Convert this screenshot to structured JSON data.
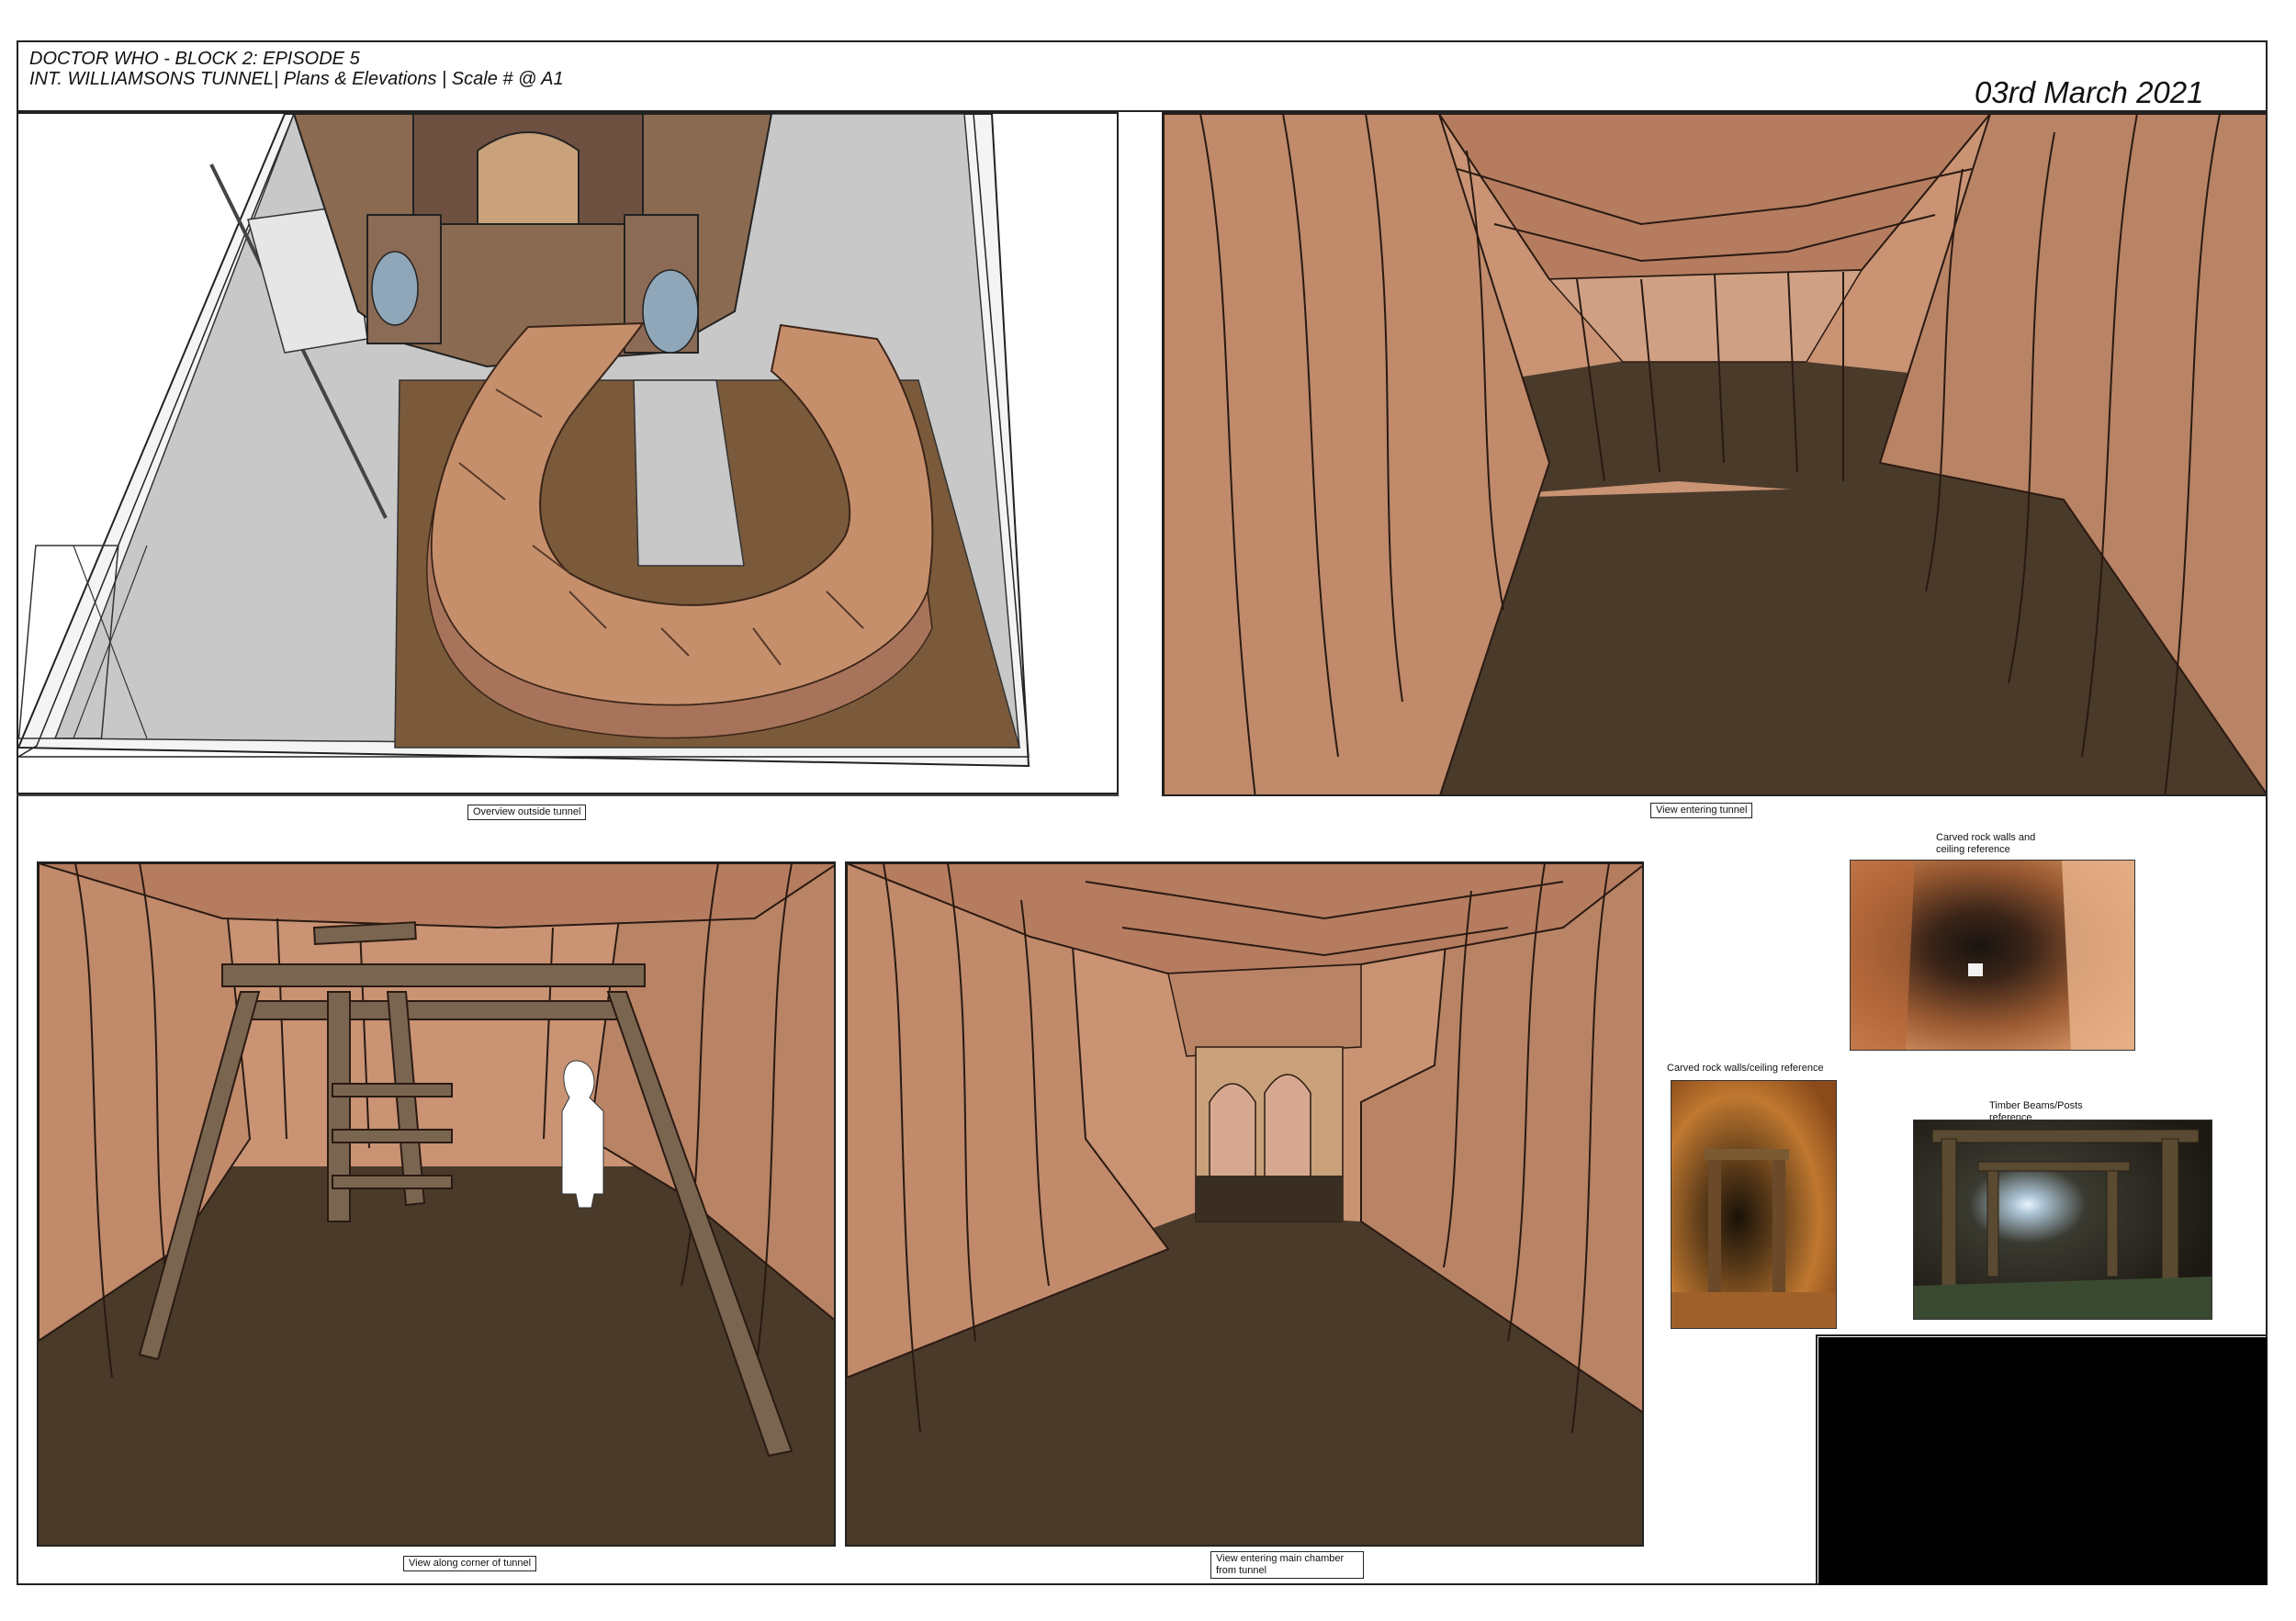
{
  "title_block": {
    "line1": "DOCTOR WHO - BLOCK 2: EPISODE 5",
    "line2": "INT. WILLIAMSONS TUNNEL| Plans & Elevations | Scale # @ A1",
    "date": "03rd March 2021"
  },
  "panels": {
    "overview_caption": "Overview outside tunnel",
    "entering_caption": "View entering tunnel",
    "corner_caption": "View along corner of tunnel",
    "chamber_caption": "View entering main chamber from tunnel"
  },
  "references": {
    "ref1_label": "Carved rock walls and ceiling reference",
    "ref2_label": "Carved rock walls/ceiling reference",
    "ref3_label": "Timber Beams/Posts reference"
  },
  "colors": {
    "rock": "#c89070",
    "rock_dark": "#8a5a40",
    "ground": "#4a3a2a",
    "timber": "#7a6550",
    "floor_plan": "#7a5a3a",
    "grey_floor": "#c8c8c8"
  }
}
